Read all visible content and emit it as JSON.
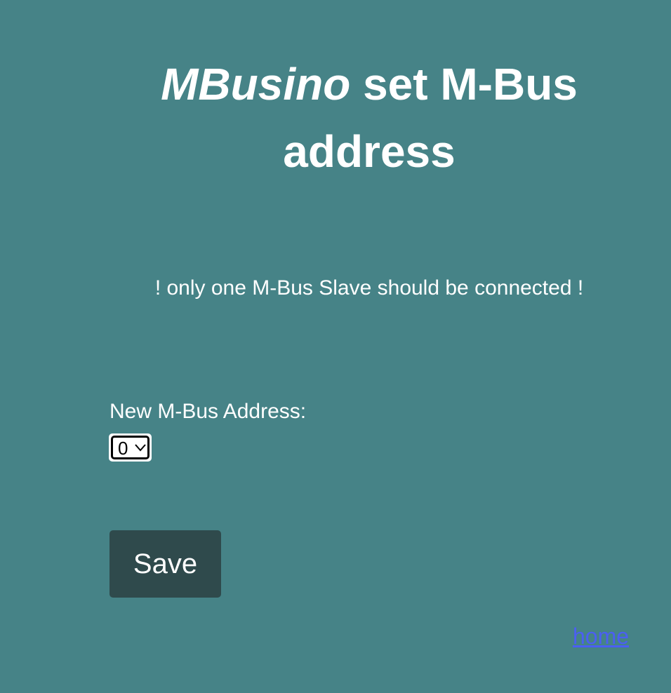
{
  "page": {
    "title_brand": "MBusino",
    "title_rest": " set M-Bus address",
    "warning": "! only one M-Bus Slave should be connected !"
  },
  "form": {
    "address_label": "New M-Bus Address:",
    "address_selected": "0",
    "save_label": "Save"
  },
  "nav": {
    "home_label": "home"
  },
  "colors": {
    "background": "#468387",
    "text": "#ffffff",
    "button_bg": "#2f4a4c",
    "link": "#4b5ff2"
  },
  "icons": {
    "dropdown": "chevron-down-icon"
  }
}
